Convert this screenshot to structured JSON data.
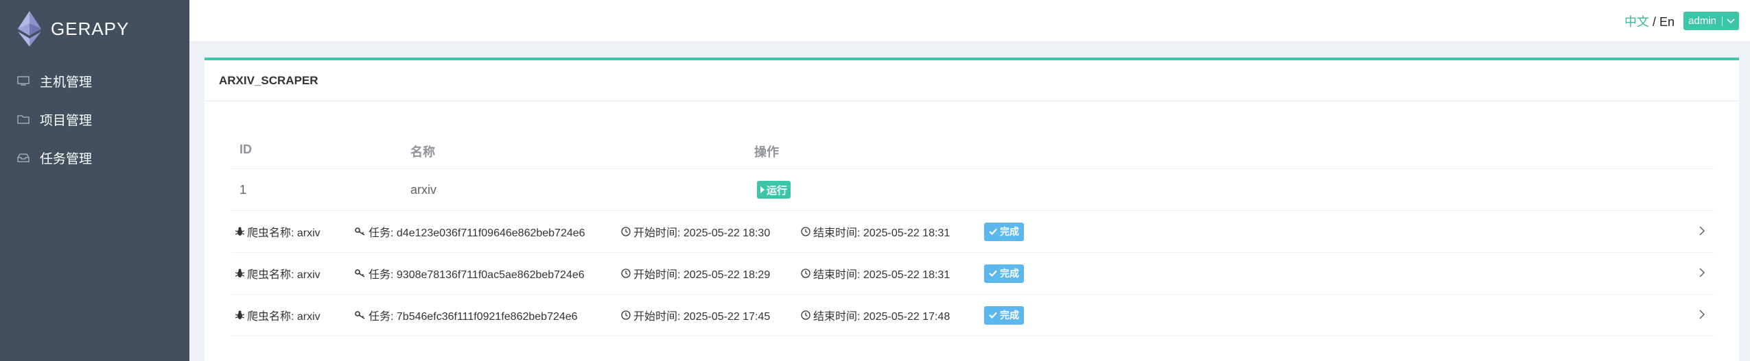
{
  "brand": {
    "name": "GERAPY",
    "logo": "ethereum-diamond-icon"
  },
  "sidebar": {
    "items": [
      {
        "label": "主机管理",
        "icon": "monitor-icon"
      },
      {
        "label": "项目管理",
        "icon": "folder-icon"
      },
      {
        "label": "任务管理",
        "icon": "inbox-icon"
      }
    ]
  },
  "header": {
    "lang_zh": "中文",
    "lang_sep": " / ",
    "lang_en": "En",
    "user": "admin"
  },
  "card": {
    "title": "ARXIV_SCRAPER",
    "table": {
      "headers": [
        "ID",
        "名称",
        "操作"
      ],
      "rows": [
        {
          "id": "1",
          "name": "arxiv",
          "action": "运行"
        }
      ]
    },
    "jobs": [
      {
        "spider_label": "爬虫名称: arxiv",
        "task_label": "任务: d4e123e036f711f09646e862beb724e6",
        "start_label": "开始时间: 2025-05-22 18:30",
        "end_label": "结束时间: 2025-05-22 18:31",
        "status": "完成"
      },
      {
        "spider_label": "爬虫名称: arxiv",
        "task_label": "任务: 9308e78136f711f0ac5ae862beb724e6",
        "start_label": "开始时间: 2025-05-22 18:29",
        "end_label": "结束时间: 2025-05-22 18:31",
        "status": "完成"
      },
      {
        "spider_label": "爬虫名称: arxiv",
        "task_label": "任务: 7b546efc36f111f0921fe862beb724e6",
        "start_label": "开始时间: 2025-05-22 17:45",
        "end_label": "结束时间: 2025-05-22 17:48",
        "status": "完成"
      }
    ]
  },
  "colors": {
    "sidebar": "#434e5f",
    "accent": "#3cc5a6",
    "success_badge": "#5cb8ec",
    "background": "#eef1f6"
  }
}
